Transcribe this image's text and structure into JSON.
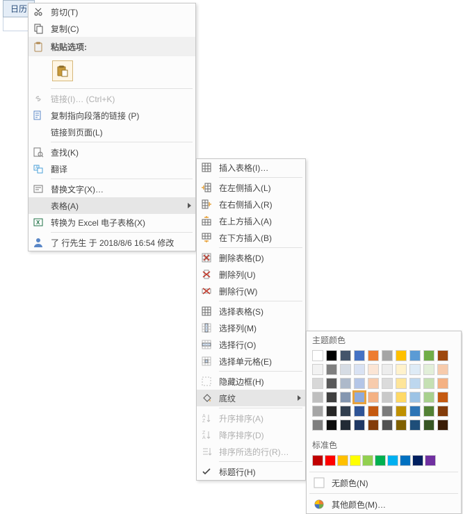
{
  "tabs": {
    "first": "日历",
    "partial1": "⊞",
    "partial2": "⊞",
    "partial3": "⊞"
  },
  "menu1": {
    "cut": "剪切(T)",
    "copy": "复制(C)",
    "paste_header": "粘贴选项:",
    "link_disabled": "链接(I)…  (Ctrl+K)",
    "copy_para_link": "复制指向段落的链接 (P)",
    "link_to_page": "链接到页面(L)",
    "find": "查找(K)",
    "translate": "翻译",
    "alt_text": "替换文字(X)…",
    "table": "表格(A)",
    "convert_excel": "转换为 Excel 电子表格(X)",
    "modified": "了 行先生 于 2018/8/6 16:54 修改"
  },
  "menu2": {
    "insert_table": "插入表格(I)…",
    "insert_left": "在左侧插入(L)",
    "insert_right": "在右侧插入(R)",
    "insert_above": "在上方插入(A)",
    "insert_below": "在下方插入(B)",
    "delete_table": "删除表格(D)",
    "delete_col": "删除列(U)",
    "delete_row": "删除行(W)",
    "select_table": "选择表格(S)",
    "select_col": "选择列(M)",
    "select_row": "选择行(O)",
    "select_cell": "选择单元格(E)",
    "hide_border": "隐藏边框(H)",
    "shading": "底纹",
    "sort_asc": "升序排序(A)",
    "sort_desc": "降序排序(D)",
    "sort_sel": "排序所选的行(R)…",
    "header_row": "标题行(H)"
  },
  "menu3": {
    "theme_title": "主题颜色",
    "std_title": "标准色",
    "no_color": "无颜色(N)",
    "more_colors": "其他颜色(M)…"
  },
  "palette": {
    "row0": [
      "#ffffff",
      "#000000",
      "#44546a",
      "#4472c4",
      "#ed7d31",
      "#a5a5a5",
      "#ffc000",
      "#5b9bd5",
      "#70ad47",
      "#9e480e"
    ],
    "row1": [
      "#f2f2f2",
      "#7f7f7f",
      "#d6dce4",
      "#d9e2f3",
      "#fbe5d5",
      "#ededed",
      "#fff2cc",
      "#deebf6",
      "#e2efd9",
      "#f7cbac"
    ],
    "row2": [
      "#d8d8d8",
      "#595959",
      "#adb9ca",
      "#b4c6e7",
      "#f7cbac",
      "#dbdbdb",
      "#fee599",
      "#bdd7ee",
      "#c5e0b3",
      "#f4b183"
    ],
    "row3": [
      "#bfbfbf",
      "#3f3f3f",
      "#8496b0",
      "#8eaadb",
      "#f4b183",
      "#c9c9c9",
      "#ffd965",
      "#9cc3e5",
      "#a8d08d",
      "#c55a11"
    ],
    "row4": [
      "#a5a5a5",
      "#262626",
      "#323f4f",
      "#2f5496",
      "#c55a11",
      "#7b7b7b",
      "#bf9000",
      "#2e75b5",
      "#538135",
      "#833c0b"
    ],
    "row5": [
      "#7f7f7f",
      "#0c0c0c",
      "#222a35",
      "#1f3864",
      "#833c0b",
      "#525252",
      "#7f6000",
      "#1e4e79",
      "#375623",
      "#3b1d06"
    ],
    "selected_index": 33,
    "standard": [
      "#c00000",
      "#ff0000",
      "#ffc000",
      "#ffff00",
      "#92d050",
      "#00b050",
      "#00b0f0",
      "#0070c0",
      "#002060",
      "#7030a0"
    ]
  }
}
